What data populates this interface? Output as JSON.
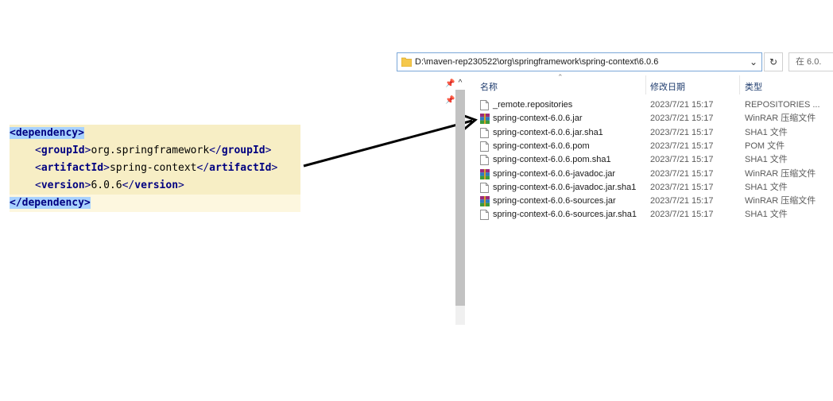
{
  "xml": {
    "line1": {
      "tag_open": "<dependency>"
    },
    "line2": {
      "open": "groupId",
      "value": "org.springframework",
      "close": "groupId"
    },
    "line3": {
      "open": "artifactId",
      "value": "spring-context",
      "close": "artifactId"
    },
    "line4": {
      "open": "version",
      "value": "6.0.6",
      "close": "version"
    },
    "line5": {
      "tag_close": "</dependency>"
    }
  },
  "explorer": {
    "address_path": "D:\\maven-rep230522\\org\\springframework\\spring-context\\6.0.6",
    "search_placeholder": "在 6.0.",
    "dropdown_icon": "chevron-down-icon",
    "refresh_icon": "refresh-icon",
    "columns": {
      "name": "名称",
      "date": "修改日期",
      "type": "类型"
    },
    "files": [
      {
        "name": "_remote.repositories",
        "date": "2023/7/21 15:17",
        "type": "REPOSITORIES ...",
        "icon": "file-icon"
      },
      {
        "name": "spring-context-6.0.6.jar",
        "date": "2023/7/21 15:17",
        "type": "WinRAR 压缩文件",
        "icon": "winrar-icon"
      },
      {
        "name": "spring-context-6.0.6.jar.sha1",
        "date": "2023/7/21 15:17",
        "type": "SHA1 文件",
        "icon": "file-icon"
      },
      {
        "name": "spring-context-6.0.6.pom",
        "date": "2023/7/21 15:17",
        "type": "POM 文件",
        "icon": "file-icon"
      },
      {
        "name": "spring-context-6.0.6.pom.sha1",
        "date": "2023/7/21 15:17",
        "type": "SHA1 文件",
        "icon": "file-icon"
      },
      {
        "name": "spring-context-6.0.6-javadoc.jar",
        "date": "2023/7/21 15:17",
        "type": "WinRAR 压缩文件",
        "icon": "winrar-icon"
      },
      {
        "name": "spring-context-6.0.6-javadoc.jar.sha1",
        "date": "2023/7/21 15:17",
        "type": "SHA1 文件",
        "icon": "file-icon"
      },
      {
        "name": "spring-context-6.0.6-sources.jar",
        "date": "2023/7/21 15:17",
        "type": "WinRAR 压缩文件",
        "icon": "winrar-icon"
      },
      {
        "name": "spring-context-6.0.6-sources.jar.sha1",
        "date": "2023/7/21 15:17",
        "type": "SHA1 文件",
        "icon": "file-icon"
      }
    ]
  },
  "colors": {
    "code_bg": "#f7eec5",
    "tag_highlight": "#a8d2ff",
    "tag": "#000080"
  }
}
